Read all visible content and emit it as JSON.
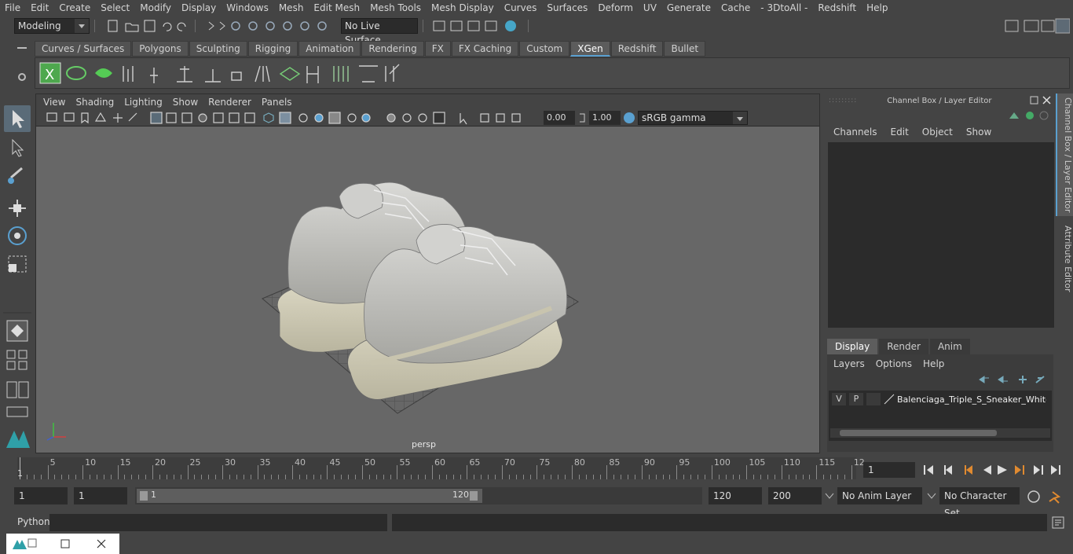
{
  "menubar": {
    "items": [
      "File",
      "Edit",
      "Create",
      "Select",
      "Modify",
      "Display",
      "Windows",
      "Mesh",
      "Edit Mesh",
      "Mesh Tools",
      "Mesh Display",
      "Curves",
      "Surfaces",
      "Deform",
      "UV",
      "Generate",
      "Cache",
      "- 3DtoAll -",
      "Redshift",
      "Help"
    ]
  },
  "status": {
    "mode": "Modeling",
    "live_surface": "No Live Surface"
  },
  "shelf": {
    "tabs": [
      "Curves / Surfaces",
      "Polygons",
      "Sculpting",
      "Rigging",
      "Animation",
      "Rendering",
      "FX",
      "FX Caching",
      "Custom",
      "XGen",
      "Redshift",
      "Bullet"
    ],
    "active_tab": "XGen"
  },
  "viewport": {
    "menu": [
      "View",
      "Shading",
      "Lighting",
      "Show",
      "Renderer",
      "Panels"
    ],
    "exposure": "0.00",
    "gamma": "1.00",
    "colorspace": "sRGB gamma",
    "camera_label": "persp"
  },
  "channelbox": {
    "title": "Channel Box / Layer Editor",
    "menu": [
      "Channels",
      "Edit",
      "Object",
      "Show"
    ],
    "layer_tabs": [
      "Display",
      "Render",
      "Anim"
    ],
    "active_layer_tab": "Display",
    "layer_menu": [
      "Layers",
      "Options",
      "Help"
    ],
    "layer": {
      "v": "V",
      "p": "P",
      "name": "Balenciaga_Triple_S_Sneaker_White_l"
    },
    "side_tabs": [
      "Channel Box / Layer Editor",
      "Attribute Editor"
    ]
  },
  "timeline": {
    "ticks": [
      "5",
      "10",
      "15",
      "20",
      "25",
      "30",
      "35",
      "40",
      "45",
      "50",
      "55",
      "60",
      "65",
      "70",
      "75",
      "80",
      "85",
      "90",
      "95",
      "100",
      "105",
      "110",
      "115",
      "12"
    ],
    "start_label": "1",
    "current_frame": "1"
  },
  "range": {
    "start": "1",
    "playback_start": "1",
    "slider_start": "1",
    "slider_end": "120",
    "playback_end": "120",
    "end": "200",
    "anim_layer": "No Anim Layer",
    "character_set": "No Character Set"
  },
  "cmdline": {
    "label": "Python"
  },
  "colors": {
    "accent": "#5aa0d0",
    "active_tab_bg": "#5d5d5d",
    "viewport_bg": "#676767"
  }
}
